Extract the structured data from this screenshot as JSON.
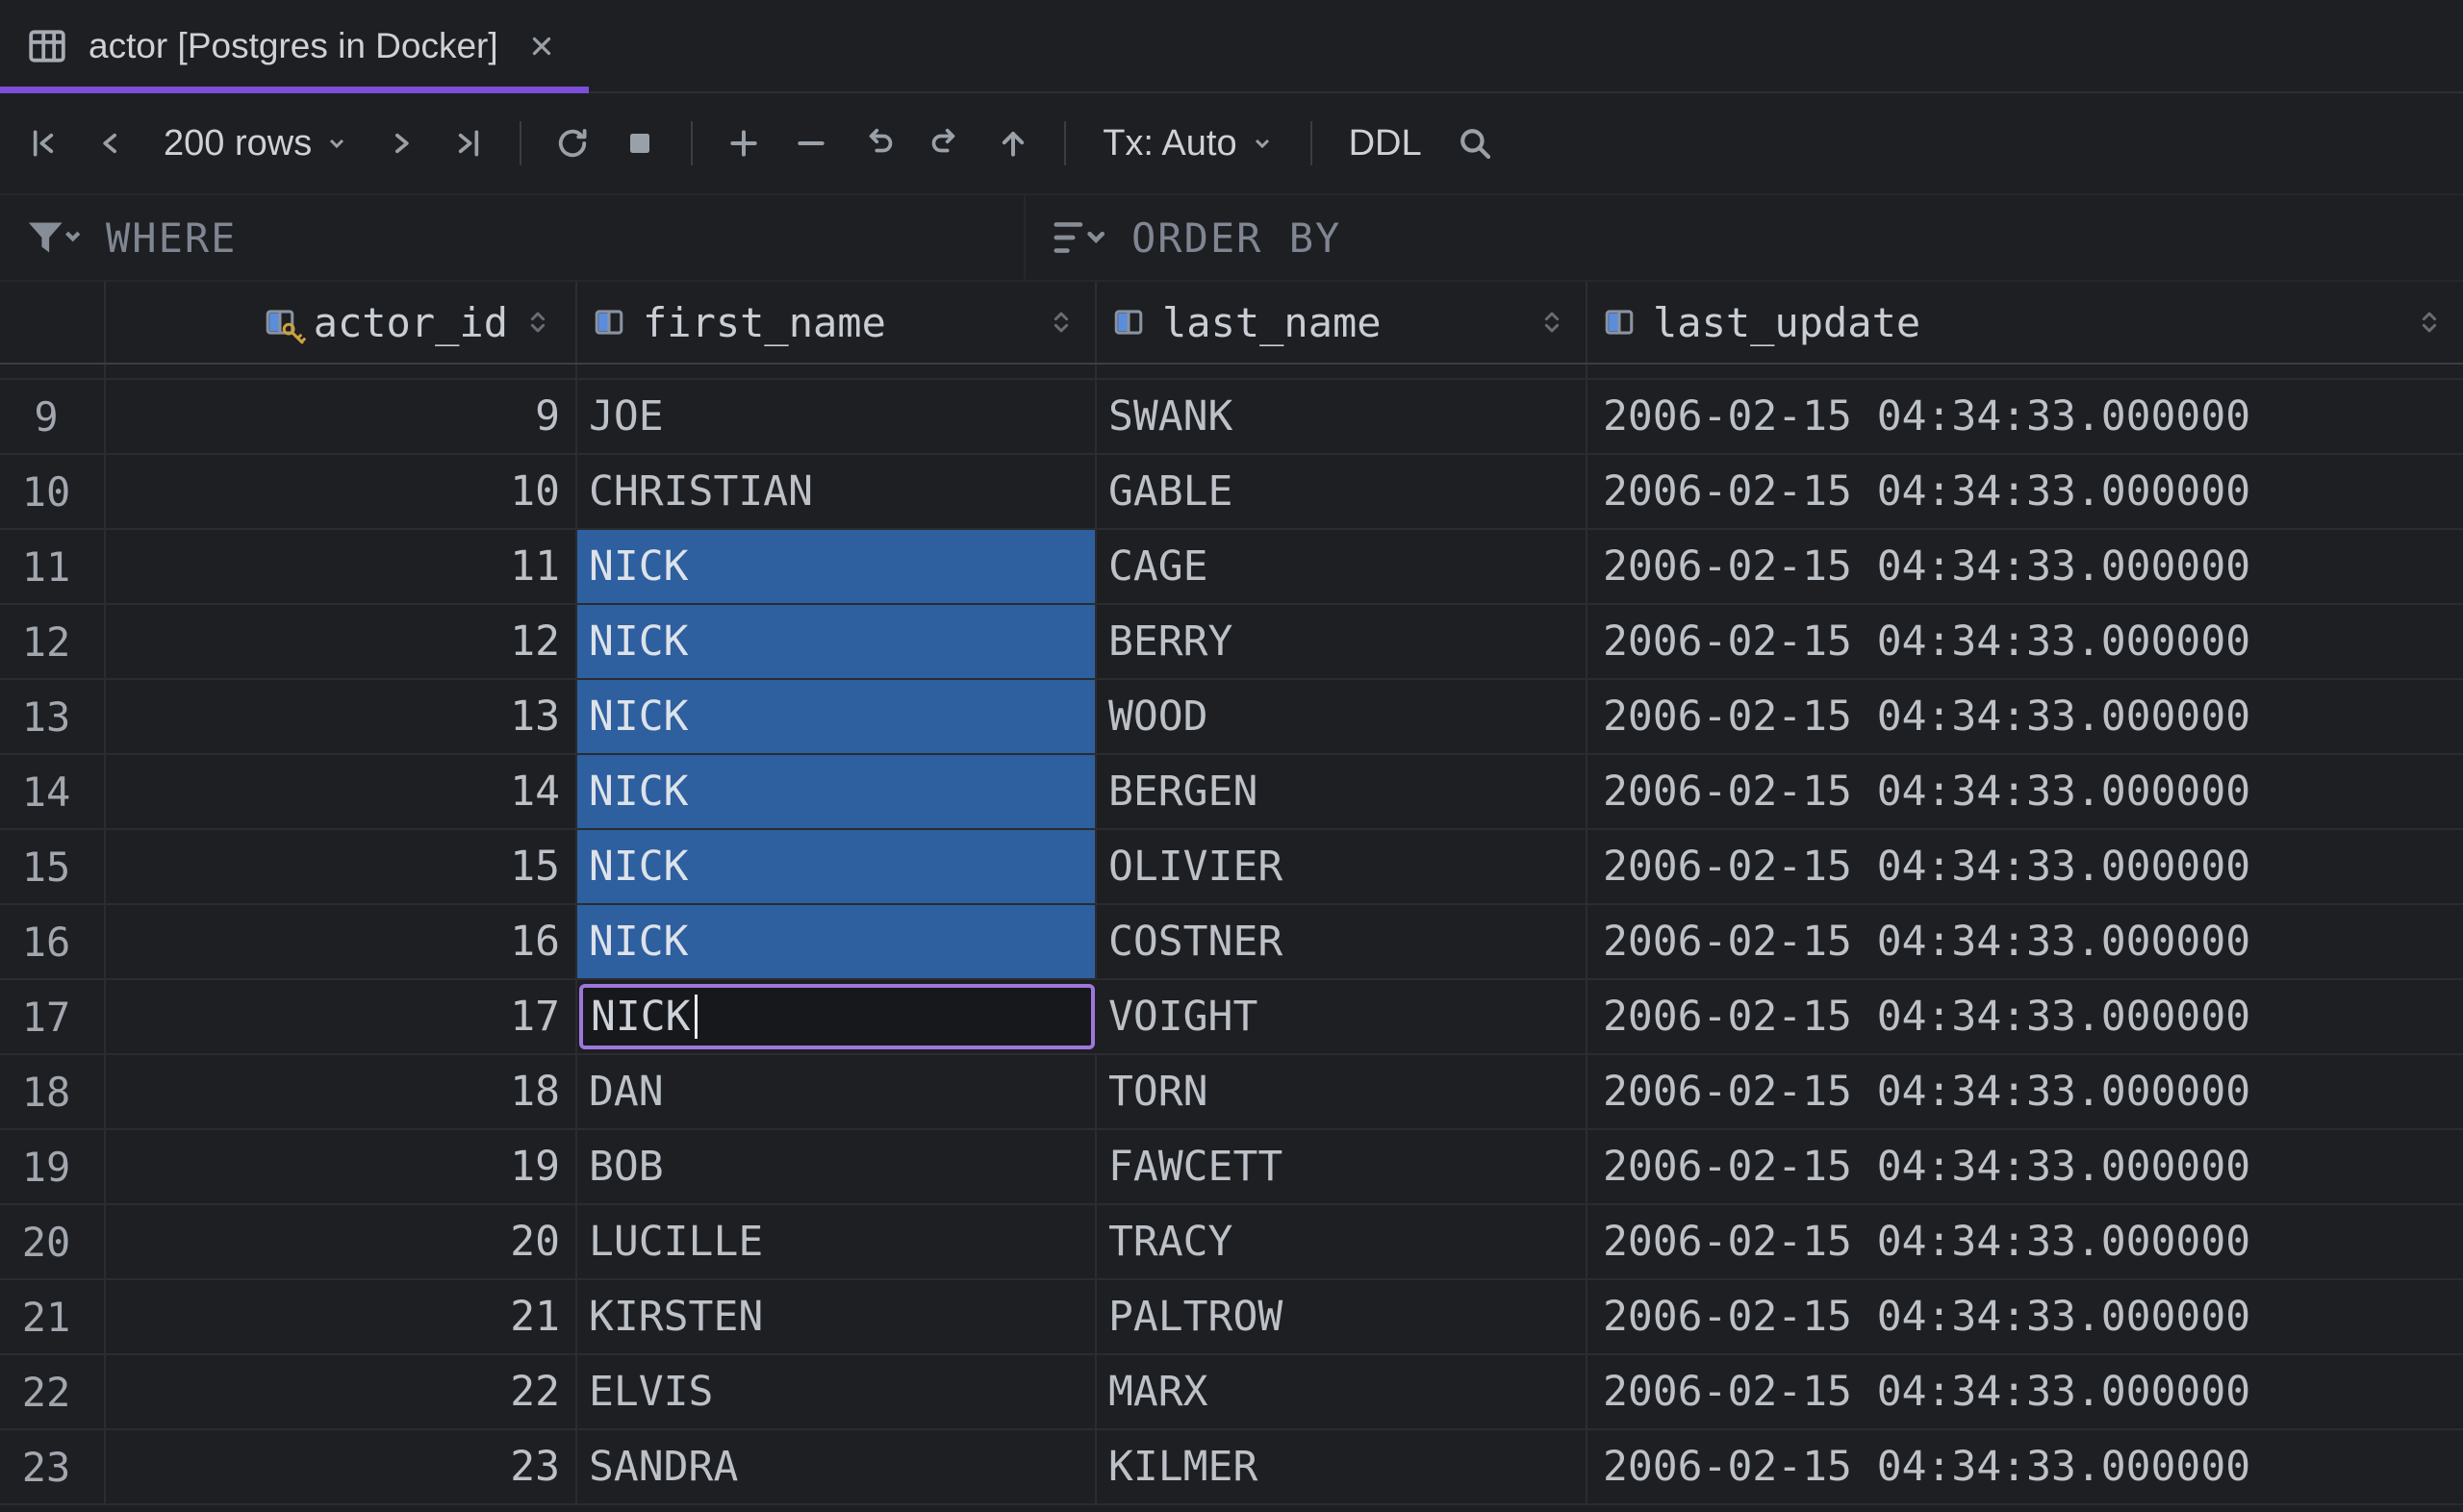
{
  "tab": {
    "title": "actor [Postgres in Docker]"
  },
  "toolbar": {
    "rows_selector_label": "200 rows",
    "tx_label": "Tx: Auto",
    "ddl_label": "DDL"
  },
  "filter_bar": {
    "where_label": "WHERE",
    "order_by_label": "ORDER BY"
  },
  "table": {
    "columns": [
      {
        "name": "actor_id",
        "align": "right",
        "primary_key": true
      },
      {
        "name": "first_name",
        "align": "left",
        "primary_key": false
      },
      {
        "name": "last_name",
        "align": "left",
        "primary_key": false
      },
      {
        "name": "last_update",
        "align": "left",
        "primary_key": false
      }
    ],
    "rows": [
      {
        "num": 9,
        "actor_id": 9,
        "first_name": "JOE",
        "last_name": "SWANK",
        "last_update": "2006-02-15 04:34:33.000000"
      },
      {
        "num": 10,
        "actor_id": 10,
        "first_name": "CHRISTIAN",
        "last_name": "GABLE",
        "last_update": "2006-02-15 04:34:33.000000"
      },
      {
        "num": 11,
        "actor_id": 11,
        "first_name": "NICK",
        "last_name": "CAGE",
        "last_update": "2006-02-15 04:34:33.000000"
      },
      {
        "num": 12,
        "actor_id": 12,
        "first_name": "NICK",
        "last_name": "BERRY",
        "last_update": "2006-02-15 04:34:33.000000"
      },
      {
        "num": 13,
        "actor_id": 13,
        "first_name": "NICK",
        "last_name": "WOOD",
        "last_update": "2006-02-15 04:34:33.000000"
      },
      {
        "num": 14,
        "actor_id": 14,
        "first_name": "NICK",
        "last_name": "BERGEN",
        "last_update": "2006-02-15 04:34:33.000000"
      },
      {
        "num": 15,
        "actor_id": 15,
        "first_name": "NICK",
        "last_name": "OLIVIER",
        "last_update": "2006-02-15 04:34:33.000000"
      },
      {
        "num": 16,
        "actor_id": 16,
        "first_name": "NICK",
        "last_name": "COSTNER",
        "last_update": "2006-02-15 04:34:33.000000"
      },
      {
        "num": 17,
        "actor_id": 17,
        "first_name": "NICK",
        "last_name": "VOIGHT",
        "last_update": "2006-02-15 04:34:33.000000"
      },
      {
        "num": 18,
        "actor_id": 18,
        "first_name": "DAN",
        "last_name": "TORN",
        "last_update": "2006-02-15 04:34:33.000000"
      },
      {
        "num": 19,
        "actor_id": 19,
        "first_name": "BOB",
        "last_name": "FAWCETT",
        "last_update": "2006-02-15 04:34:33.000000"
      },
      {
        "num": 20,
        "actor_id": 20,
        "first_name": "LUCILLE",
        "last_name": "TRACY",
        "last_update": "2006-02-15 04:34:33.000000"
      },
      {
        "num": 21,
        "actor_id": 21,
        "first_name": "KIRSTEN",
        "last_name": "PALTROW",
        "last_update": "2006-02-15 04:34:33.000000"
      },
      {
        "num": 22,
        "actor_id": 22,
        "first_name": "ELVIS",
        "last_name": "MARX",
        "last_update": "2006-02-15 04:34:33.000000"
      },
      {
        "num": 23,
        "actor_id": 23,
        "first_name": "SANDRA",
        "last_name": "KILMER",
        "last_update": "2006-02-15 04:34:33.000000"
      }
    ],
    "selected_first_name_rows": [
      11,
      12,
      13,
      14,
      15,
      16
    ],
    "editing": {
      "row": 17,
      "column": "first_name",
      "value": "NICK"
    }
  },
  "colors": {
    "background": "#1e1f22",
    "accent_purple": "#7d4fd8",
    "edit_cell_border": "#9e77dd",
    "selection_blue": "#2e5f9f",
    "key_gold": "#c9a33c",
    "column_icon_blue": "#5b8ddb",
    "grid_line": "#2a2c30",
    "text": "#bcc0c7"
  },
  "icons": {
    "table-icon": "grid",
    "close-icon": "x-cross",
    "first-row-icon": "bar+chevron-left",
    "previous-icon": "chevron-left",
    "next-icon": "chevron-right",
    "last-row-icon": "chevron-right+bar",
    "refresh-icon": "circular-arrow",
    "stop-icon": "filled-square",
    "add-row-icon": "plus",
    "delete-row-icon": "minus",
    "undo-icon": "curved-arrow-left",
    "revert-icon": "curved-arrow-right",
    "submit-icon": "arrow-up",
    "search-icon": "magnifier",
    "filter-icon": "funnel+chevron-down",
    "order-by-icon": "sort-lines+chevron-down",
    "sort-icon": "chevron-up-down",
    "key-icon": "gold-key",
    "chevron-down-icon": "chevron-down"
  }
}
